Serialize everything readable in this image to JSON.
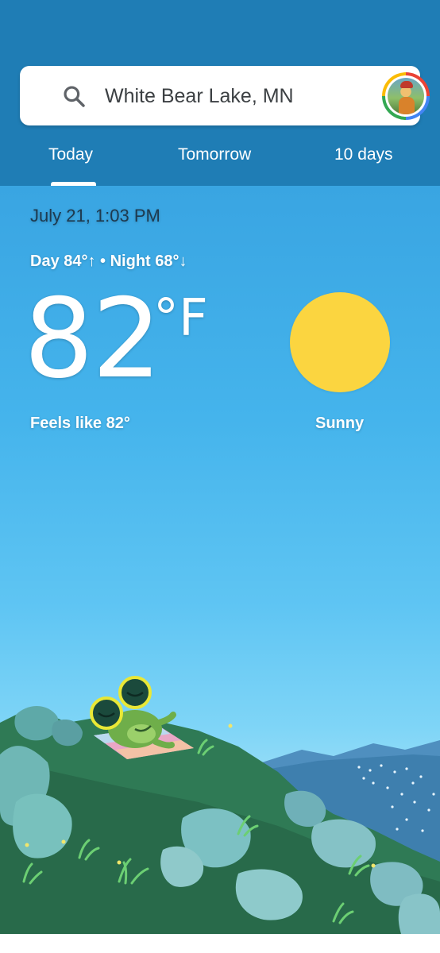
{
  "search": {
    "location": "White Bear Lake, MN",
    "icon": "search-icon"
  },
  "tabs": [
    {
      "label": "Today",
      "selected": true
    },
    {
      "label": "Tomorrow",
      "selected": false
    },
    {
      "label": "10 days",
      "selected": false
    }
  ],
  "weather": {
    "datetime": "July 21, 1:03 PM",
    "day_night": "Day 84°↑ • Night 68°↓",
    "temperature": "82",
    "unit": "°F",
    "feels_like": "Feels like 82°",
    "condition": "Sunny",
    "condition_icon": "sun-icon"
  },
  "colors": {
    "header": "#1f7db5",
    "sky_top": "#2f9ad7",
    "sun": "#fbd540",
    "hill": "#2f7a55"
  }
}
